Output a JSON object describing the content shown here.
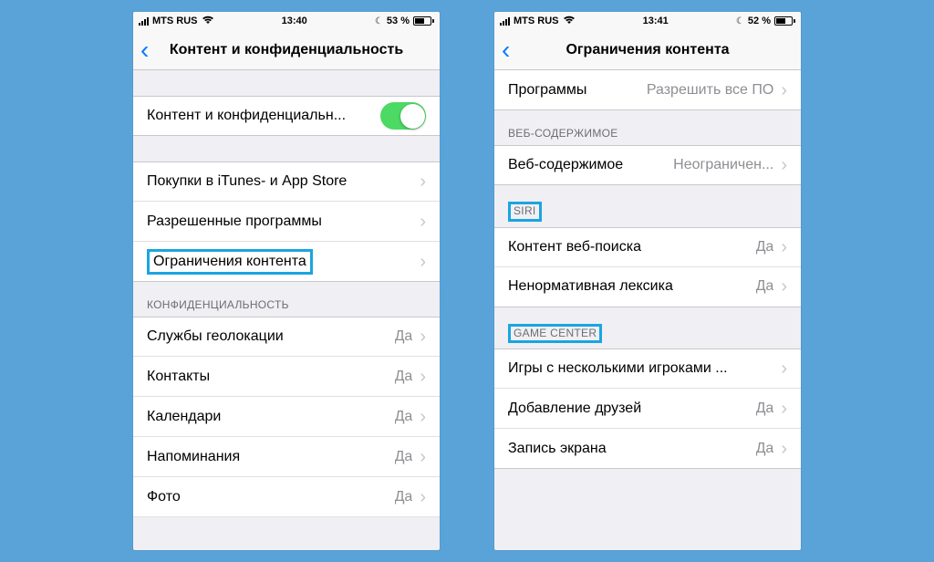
{
  "left": {
    "status": {
      "carrier": "MTS RUS",
      "time": "13:40",
      "battery": "53 %"
    },
    "nav_title": "Контент и конфиденциальность",
    "toggle_row": {
      "label": "Контент и конфиденциальн..."
    },
    "group1": [
      {
        "label": "Покупки в iTunes- и App Store"
      },
      {
        "label": "Разрешенные программы"
      },
      {
        "label": "Ограничения контента",
        "highlighted": true
      }
    ],
    "privacy_header": "КОНФИДЕНЦИАЛЬНОСТЬ",
    "privacy_rows": [
      {
        "label": "Службы геолокации",
        "value": "Да"
      },
      {
        "label": "Контакты",
        "value": "Да"
      },
      {
        "label": "Календари",
        "value": "Да"
      },
      {
        "label": "Напоминания",
        "value": "Да"
      },
      {
        "label": "Фото",
        "value": "Да"
      }
    ]
  },
  "right": {
    "status": {
      "carrier": "MTS RUS",
      "time": "13:41",
      "battery": "52 %"
    },
    "nav_title": "Ограничения контента",
    "top_row": {
      "label": "Программы",
      "value": "Разрешить все ПО"
    },
    "web_header": "ВЕБ-СОДЕРЖИМОЕ",
    "web_row": {
      "label": "Веб-содержимое",
      "value": "Неограничен..."
    },
    "siri_header": "SIRI",
    "siri_rows": [
      {
        "label": "Контент веб-поиска",
        "value": "Да"
      },
      {
        "label": "Ненормативная лексика",
        "value": "Да"
      }
    ],
    "gc_header": "GAME CENTER",
    "gc_rows": [
      {
        "label": "Игры с несколькими игроками ...",
        "value": ""
      },
      {
        "label": "Добавление друзей",
        "value": "Да"
      },
      {
        "label": "Запись экрана",
        "value": "Да"
      }
    ]
  }
}
